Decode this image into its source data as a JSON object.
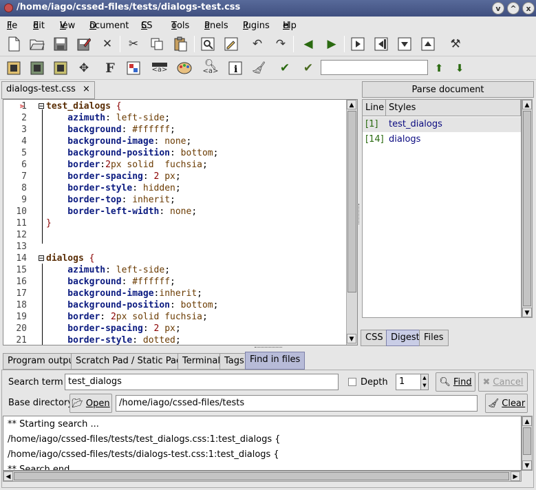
{
  "window": {
    "title": "/home/iago/cssed-files/tests/dialogs-test.css",
    "buttons": [
      "v",
      "^",
      "x"
    ]
  },
  "menu": [
    {
      "label": "File",
      "u": "F",
      "rest": "ile"
    },
    {
      "label": "Edit",
      "u": "E",
      "rest": "dit"
    },
    {
      "label": "View",
      "u": "V",
      "rest": "iew"
    },
    {
      "label": "Document",
      "u": "D",
      "rest": "ocument"
    },
    {
      "label": "CSS",
      "u": "C",
      "rest": "SS"
    },
    {
      "label": "Tools",
      "u": "T",
      "rest": "ools"
    },
    {
      "label": "Panels",
      "u": "P",
      "rest": "anels"
    },
    {
      "label": "Plugins",
      "u": "P",
      "rest": "lugins"
    },
    {
      "label": "Help",
      "u": "H",
      "rest": "elp"
    }
  ],
  "toolbar2": {
    "bold_label": "F",
    "tag_label": "<a>",
    "search_value": ""
  },
  "editor_tab": {
    "label": "dialogs-test.css",
    "close": "×"
  },
  "code": [
    {
      "n": "1",
      "fold": "⊟",
      "parts": [
        [
          "sel",
          "test_dialogs"
        ],
        [
          "pun",
          " {"
        ]
      ]
    },
    {
      "n": "2",
      "parts": [
        [
          "prop",
          "    azimuth"
        ],
        [
          "",
          ": "
        ],
        [
          "val",
          "left-side"
        ],
        [
          "",
          ";"
        ]
      ]
    },
    {
      "n": "3",
      "parts": [
        [
          "prop",
          "    background"
        ],
        [
          "",
          ": "
        ],
        [
          "val",
          "#ffffff"
        ],
        [
          "",
          ";"
        ]
      ]
    },
    {
      "n": "4",
      "parts": [
        [
          "prop",
          "    background-image"
        ],
        [
          "",
          ": "
        ],
        [
          "val",
          "none"
        ],
        [
          "",
          ";"
        ]
      ]
    },
    {
      "n": "5",
      "parts": [
        [
          "prop",
          "    background-position"
        ],
        [
          "",
          ": "
        ],
        [
          "val",
          "bottom"
        ],
        [
          "",
          ";"
        ]
      ]
    },
    {
      "n": "6",
      "parts": [
        [
          "prop",
          "    border"
        ],
        [
          "",
          ":"
        ],
        [
          "num",
          "2"
        ],
        [
          "val",
          "px solid  fuchsia"
        ],
        [
          "",
          ";"
        ]
      ]
    },
    {
      "n": "7",
      "parts": [
        [
          "prop",
          "    border-spacing"
        ],
        [
          "",
          ": "
        ],
        [
          "num",
          "2"
        ],
        [
          "val",
          " px"
        ],
        [
          "",
          ";"
        ]
      ]
    },
    {
      "n": "8",
      "parts": [
        [
          "prop",
          "    border-style"
        ],
        [
          "",
          ": "
        ],
        [
          "val",
          "hidden"
        ],
        [
          "",
          ";"
        ]
      ]
    },
    {
      "n": "9",
      "parts": [
        [
          "prop",
          "    border-top"
        ],
        [
          "",
          ": "
        ],
        [
          "val",
          "inherit"
        ],
        [
          "",
          ";"
        ]
      ]
    },
    {
      "n": "10",
      "parts": [
        [
          "prop",
          "    border-left-width"
        ],
        [
          "",
          ": "
        ],
        [
          "val",
          "none"
        ],
        [
          "",
          ";"
        ]
      ]
    },
    {
      "n": "11",
      "parts": [
        [
          "pun",
          "}"
        ]
      ]
    },
    {
      "n": "12",
      "parts": []
    },
    {
      "n": "13",
      "parts": []
    },
    {
      "n": "14",
      "fold": "⊟",
      "parts": [
        [
          "sel",
          "dialogs"
        ],
        [
          "pun",
          " {"
        ]
      ]
    },
    {
      "n": "15",
      "parts": [
        [
          "prop",
          "    azimuth"
        ],
        [
          "",
          ": "
        ],
        [
          "val",
          "left-side"
        ],
        [
          "",
          ";"
        ]
      ]
    },
    {
      "n": "16",
      "parts": [
        [
          "prop",
          "    background"
        ],
        [
          "",
          ": "
        ],
        [
          "val",
          "#ffffff"
        ],
        [
          "",
          ";"
        ]
      ]
    },
    {
      "n": "17",
      "parts": [
        [
          "prop",
          "    background-image"
        ],
        [
          "",
          ":"
        ],
        [
          "val",
          "inherit"
        ],
        [
          "",
          ";"
        ]
      ]
    },
    {
      "n": "18",
      "parts": [
        [
          "prop",
          "    background-position"
        ],
        [
          "",
          ": "
        ],
        [
          "val",
          "bottom"
        ],
        [
          "",
          ";"
        ]
      ]
    },
    {
      "n": "19",
      "parts": [
        [
          "prop",
          "    border"
        ],
        [
          "",
          ": "
        ],
        [
          "num",
          "2"
        ],
        [
          "val",
          "px solid fuchsia"
        ],
        [
          "",
          ";"
        ]
      ]
    },
    {
      "n": "20",
      "parts": [
        [
          "prop",
          "    border-spacing"
        ],
        [
          "",
          ": "
        ],
        [
          "num",
          "2"
        ],
        [
          "val",
          " px"
        ],
        [
          "",
          ";"
        ]
      ]
    },
    {
      "n": "21",
      "parts": [
        [
          "prop",
          "    border-style"
        ],
        [
          "",
          ": "
        ],
        [
          "val",
          "dotted"
        ],
        [
          "",
          ";"
        ]
      ]
    }
  ],
  "right_panel": {
    "header": "Parse document",
    "columns": [
      "Line",
      "Styles"
    ],
    "rows": [
      {
        "line": "[1]",
        "style": "test_dialogs"
      },
      {
        "line": "[14]",
        "style": "dialogs"
      }
    ],
    "tabs": [
      "CSS",
      "Digest",
      "Files"
    ],
    "active_tab": "Digest"
  },
  "bottom_tabs": [
    "Program output",
    "Scratch Pad / Static Pad",
    "Terminal",
    "Tags",
    "Find in files"
  ],
  "find": {
    "search_label": "Search term",
    "search_value": "test_dialogs",
    "depth_label": "Depth",
    "depth_value": "1",
    "find_label": "Find",
    "cancel_label": "Cancel",
    "base_label": "Base directory",
    "open_label": "Open",
    "base_value": "/home/iago/cssed-files/tests",
    "clear_label": "Clear"
  },
  "results": [
    "** Starting search ...",
    "/home/iago/cssed-files/tests/test_dialogs.css:1:test_dialogs {",
    "/home/iago/cssed-files/tests/dialogs-test.css:1:test_dialogs {",
    "** Search end"
  ],
  "colors": {
    "title_bar": "#4a5a8a",
    "active_tab": "#c9cde6",
    "selector": "#5a2e06",
    "property": "#0a1a80",
    "value": "#6a3a00",
    "number": "#8a0000"
  }
}
